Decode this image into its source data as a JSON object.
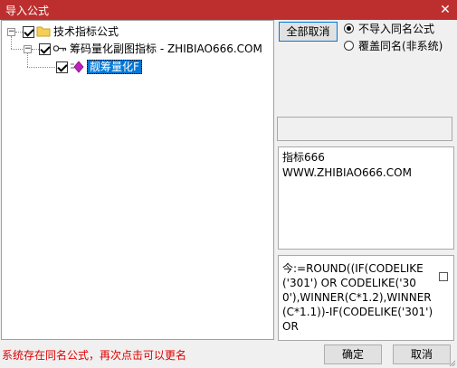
{
  "window": {
    "title": "导入公式",
    "close_glyph": "✕"
  },
  "tree": {
    "root": {
      "label": "技术指标公式",
      "expander": "−",
      "checked": true
    },
    "child": {
      "label": "筹码量化副图指标 - ZHIBIAO666.COM",
      "expander": "−",
      "checked": true
    },
    "leaf": {
      "label": "靓筹量化F",
      "checked": true,
      "selected": true
    }
  },
  "options": {
    "deselect_all_label": "全部取消",
    "radio_no_import_label": "不导入同名公式",
    "radio_overwrite_label": "覆盖同名(非系统)",
    "selected": "no_import"
  },
  "info_box": {
    "line1": "指标666",
    "line2": "WWW.ZHIBIAO666.COM"
  },
  "code_box": {
    "text": "今:=ROUND((IF(CODELIKE('301') OR CODELIKE('300'),WINNER(C*1.2),WINNER(C*1.1))-IF(CODELIKE('301') OR"
  },
  "status_text": "系统存在同名公式，再次点击可以更名",
  "buttons": {
    "ok_label": "确定",
    "cancel_label": "取消"
  },
  "colors": {
    "titlebar": "#bd2f2f",
    "selection": "#0078d7",
    "status": "#e00000"
  }
}
